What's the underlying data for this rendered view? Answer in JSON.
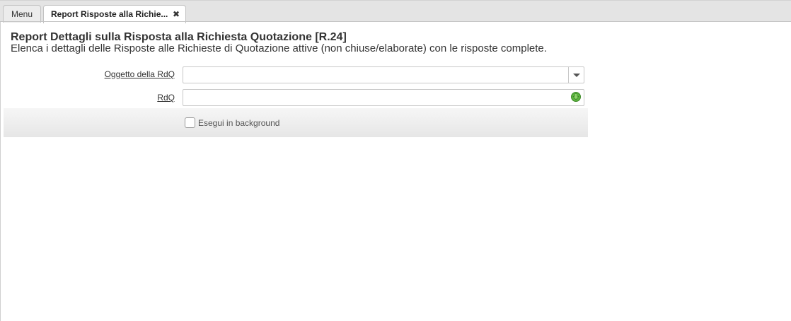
{
  "tabs": {
    "menu_label": "Menu",
    "active_label": "Report Risposte alla Richie...",
    "close_glyph": "✖"
  },
  "header": {
    "title": "Report Dettagli sulla Risposta alla Richiesta Quotazione [R.24]",
    "description": "Elenca i dettagli delle Risposte alle Richieste di Quotazione attive (non chiuse/elaborate) con le risposte complete."
  },
  "form": {
    "oggetto": {
      "label": "Oggetto della RdQ",
      "value": "",
      "control_icon": "chevron-down-icon"
    },
    "rdq": {
      "label": "RdQ",
      "value": "",
      "control_icon": "green-arrow-down-icon",
      "icon_color": "#4fa43a"
    },
    "background": {
      "label": "Esegui in background",
      "checked": false
    }
  },
  "colors": {
    "tab_bar": "#e4e4e4",
    "option_bar": "#ececec",
    "text": "#333333"
  }
}
